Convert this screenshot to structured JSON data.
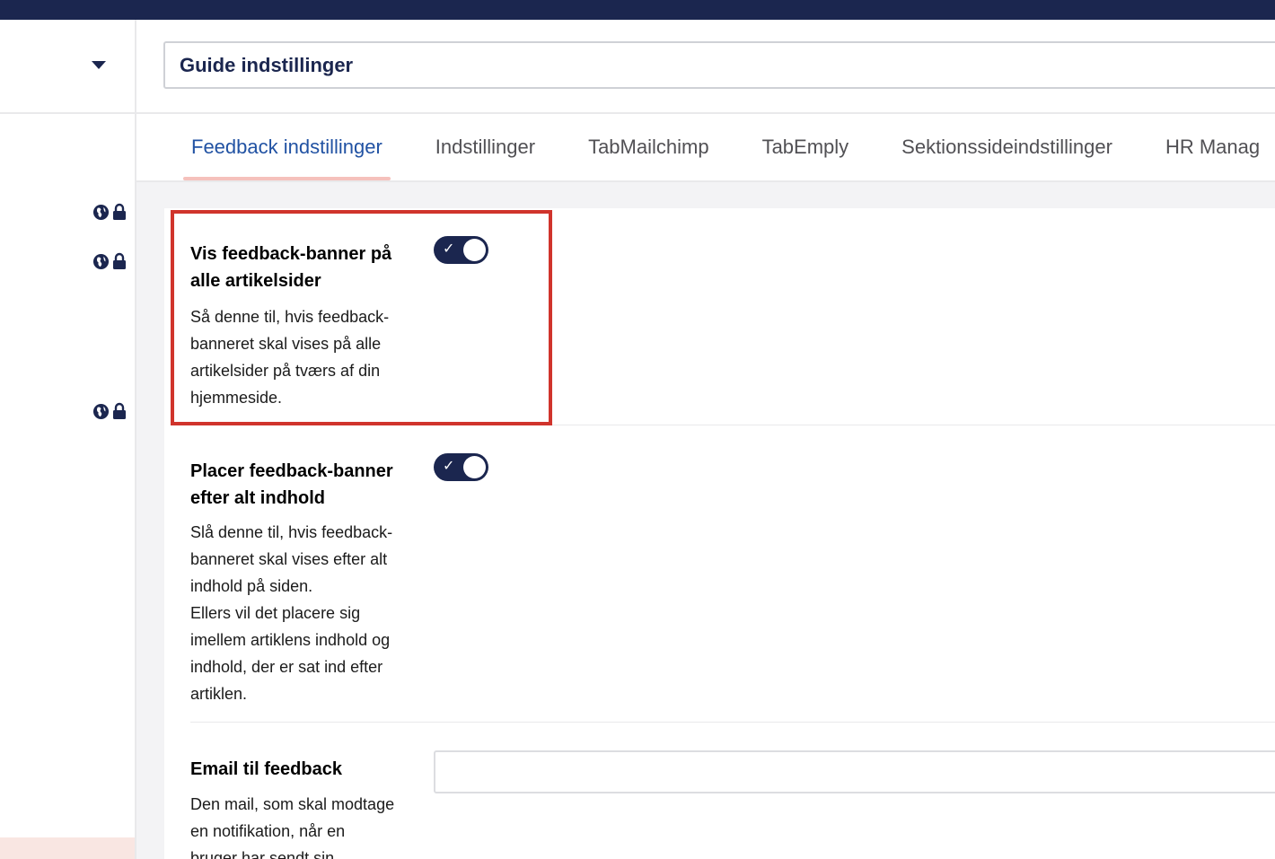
{
  "header": {
    "name_value": "Guide indstillinger"
  },
  "tabs": [
    {
      "label": "Feedback indstillinger",
      "active": true
    },
    {
      "label": "Indstillinger",
      "active": false
    },
    {
      "label": "TabMailchimp",
      "active": false
    },
    {
      "label": "TabEmply",
      "active": false
    },
    {
      "label": "Sektionssideindstillinger",
      "active": false
    },
    {
      "label": "HR Manag",
      "active": false
    }
  ],
  "properties": [
    {
      "label_line1": "Vis feedback-banner på",
      "label_line2": "alle artikelsider",
      "desc_lines": [
        "Så denne til, hvis feedback-",
        "banneret skal vises på alle",
        "artikelsider på tværs af din",
        "hjemmeside."
      ],
      "toggle_on": true
    },
    {
      "label_line1": "Placer feedback-banner",
      "label_line2": "efter alt indhold",
      "desc_lines": [
        "Slå denne til, hvis feedback-",
        "banneret skal vises efter alt",
        "indhold på siden.",
        "Ellers vil det placere sig",
        "imellem artiklens indhold og",
        "indhold, der er sat ind efter",
        "artiklen."
      ],
      "toggle_on": true
    },
    {
      "label_line1": "Email til feedback",
      "desc_lines": [
        "Den mail, som skal modtage",
        "en notifikation, når en",
        "bruger har sendt sin"
      ],
      "email_value": ""
    }
  ],
  "icons": {
    "dropdown": "caret-down-icon",
    "globe": "globe-icon",
    "lock": "lock-icon",
    "toggle_check": "✓"
  },
  "colors": {
    "topbar": "#1b264f",
    "accent": "#2152a3",
    "toggle_on": "#1b264f",
    "tab_indicator": "#f5c1bc",
    "highlight": "#d0342c"
  }
}
